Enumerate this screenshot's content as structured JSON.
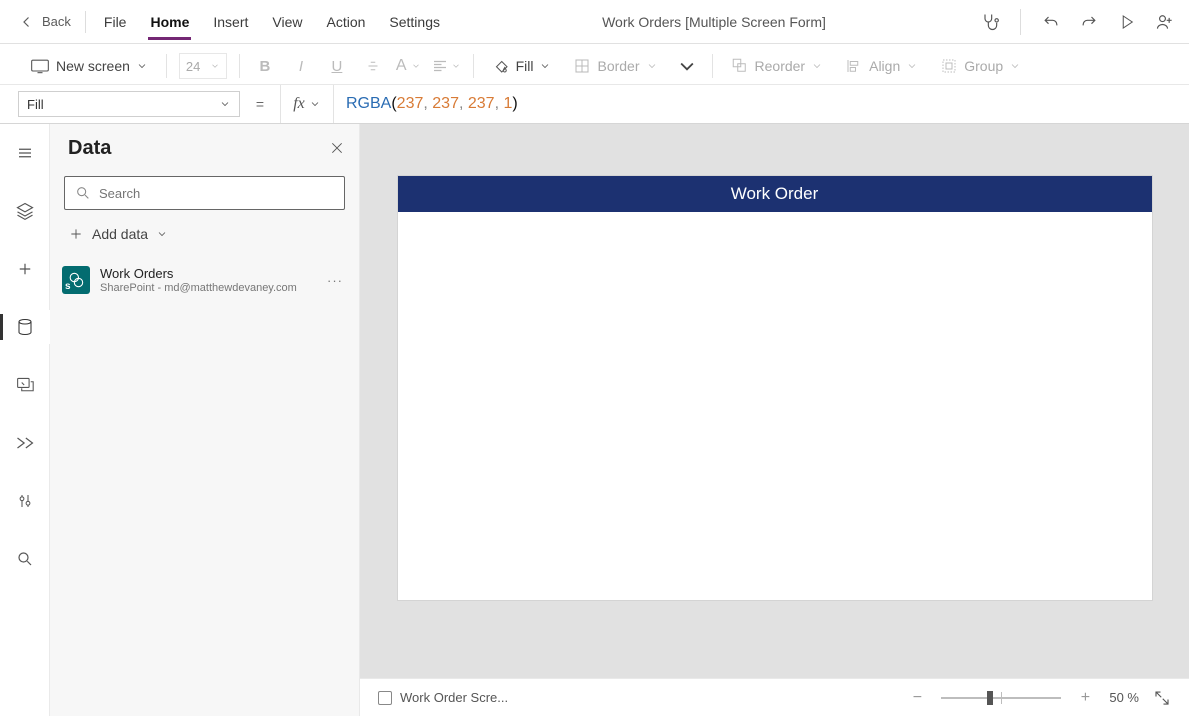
{
  "menubar": {
    "back": "Back",
    "tabs": {
      "file": "File",
      "home": "Home",
      "insert": "Insert",
      "view": "View",
      "action": "Action",
      "settings": "Settings"
    },
    "title": "Work Orders [Multiple Screen Form]"
  },
  "ribbon": {
    "new_screen": "New screen",
    "font_size": "24",
    "fill": "Fill",
    "border": "Border",
    "reorder": "Reorder",
    "align": "Align",
    "group": "Group"
  },
  "formula": {
    "property": "Fill",
    "fx": "fx",
    "equals": "=",
    "tokens": {
      "fn": "RGBA",
      "a": "237",
      "b": "237",
      "c": "237",
      "d": "1"
    }
  },
  "data_panel": {
    "title": "Data",
    "search_placeholder": "Search",
    "add_data": "Add data",
    "source": {
      "title": "Work Orders",
      "subtitle": "SharePoint - md@matthewdevaney.com"
    }
  },
  "canvas": {
    "header_text": "Work Order"
  },
  "footer": {
    "screen_name": "Work Order Scre...",
    "zoom": "50  %"
  }
}
